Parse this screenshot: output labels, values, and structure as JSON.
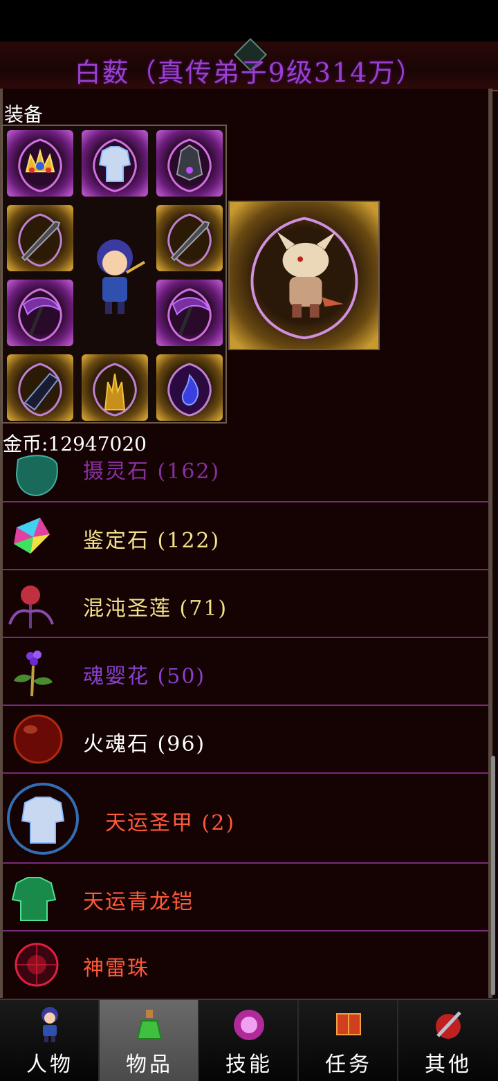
{
  "title": "白薮（真传弟子9级314万）",
  "equipment": {
    "label": "装备"
  },
  "gold": {
    "text": "金币:12947020"
  },
  "items": [
    {
      "name": "摄灵石 (162)",
      "color": "#8a2fa0",
      "icon": "soul-stone-icon"
    },
    {
      "name": "鉴定石 (122)",
      "color": "#f3e28a",
      "icon": "appraisal-crystal-icon"
    },
    {
      "name": "混沌圣莲 (71)",
      "color": "#f3e28a",
      "icon": "chaos-lotus-icon"
    },
    {
      "name": "魂婴花 (50)",
      "color": "#8a3fd0",
      "icon": "soul-flower-icon"
    },
    {
      "name": "火魂石 (96)",
      "color": "#ffffff",
      "icon": "fire-stone-icon"
    },
    {
      "name": "天运圣甲 (2)",
      "color": "#ff5a3a",
      "icon": "holy-armor-icon"
    },
    {
      "name": "天运青龙铠",
      "color": "#ff5a3a",
      "icon": "dragon-armor-icon"
    },
    {
      "name": "神雷珠",
      "color": "#ff5a3a",
      "icon": "thunder-orb-icon"
    }
  ],
  "nav": [
    {
      "label": "人物",
      "icon": "character-icon",
      "active": false
    },
    {
      "label": "物品",
      "icon": "potion-icon",
      "active": true
    },
    {
      "label": "技能",
      "icon": "skill-orb-icon",
      "active": false
    },
    {
      "label": "任务",
      "icon": "quest-book-icon",
      "active": false
    },
    {
      "label": "其他",
      "icon": "other-icon",
      "active": false
    }
  ],
  "colors": {
    "title": "#9b3fd0",
    "divider": "#7a2a7a",
    "background": "#150304"
  }
}
